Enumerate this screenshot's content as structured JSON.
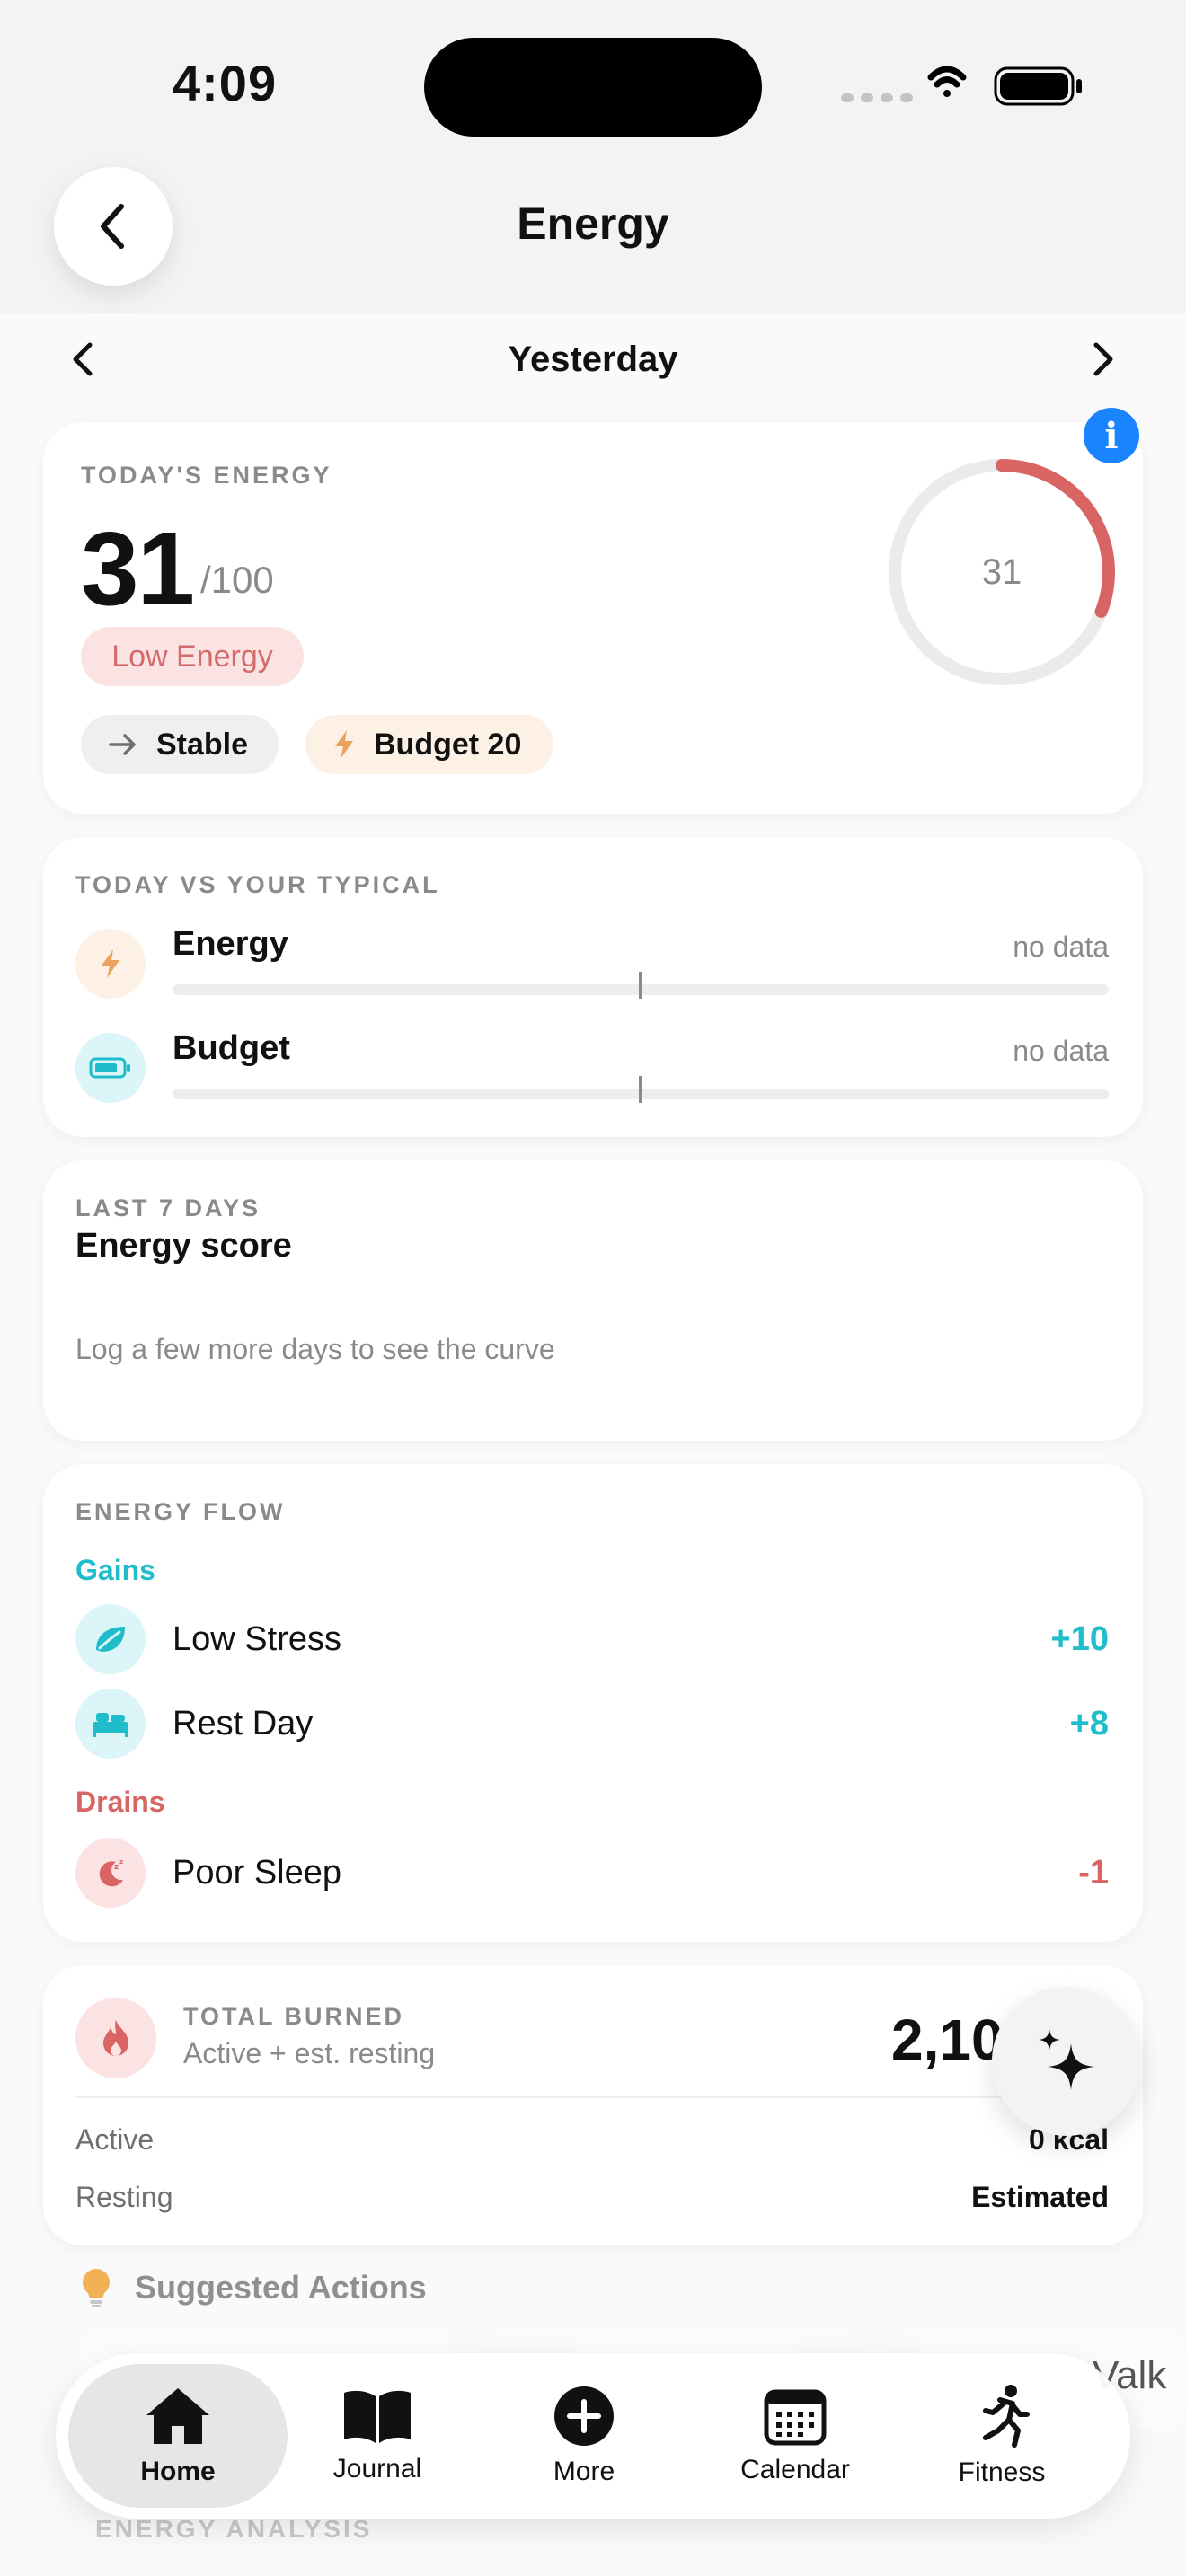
{
  "status_bar": {
    "time": "4:09"
  },
  "header": {
    "title": "Energy"
  },
  "date_nav": {
    "label": "Yesterday"
  },
  "today_energy": {
    "eyebrow": "TODAY'S ENERGY",
    "score": "31",
    "max": "/100",
    "level_badge": "Low Energy",
    "trend_label": "Stable",
    "budget_label": "Budget 20",
    "ring_value": "31",
    "ring_fraction": 0.31,
    "accent_color": "#d96464"
  },
  "typical": {
    "eyebrow": "TODAY VS YOUR TYPICAL",
    "metrics": [
      {
        "name": "Energy",
        "value": "no data",
        "icon": "lightning-icon"
      },
      {
        "name": "Budget",
        "value": "no data",
        "icon": "battery-icon"
      }
    ]
  },
  "last7": {
    "eyebrow": "LAST 7 DAYS",
    "title": "Energy score",
    "empty_message": "Log a few more days to see the curve"
  },
  "flow": {
    "eyebrow": "ENERGY FLOW",
    "gains_label": "Gains",
    "drains_label": "Drains",
    "gains": [
      {
        "name": "Low Stress",
        "value": "+10",
        "icon": "leaf-icon"
      },
      {
        "name": "Rest Day",
        "value": "+8",
        "icon": "bed-icon"
      }
    ],
    "drains": [
      {
        "name": "Poor Sleep",
        "value": "-1",
        "icon": "moon-sleep-icon"
      }
    ],
    "gain_color": "#1fbccb",
    "drain_color": "#d96464"
  },
  "burned": {
    "eyebrow": "TOTAL BURNED",
    "subtitle": "Active + est. resting",
    "total": "2,10",
    "active_label": "Active",
    "active_value": "0 kcal",
    "resting_label": "Resting",
    "resting_value": "Estimated"
  },
  "suggested": {
    "label": "Suggested Actions",
    "overflow_text": "Valk"
  },
  "analysis": {
    "eyebrow": "ENERGY ANALYSIS"
  },
  "tabs": [
    {
      "label": "Home",
      "icon": "home-icon",
      "selected": true
    },
    {
      "label": "Journal",
      "icon": "book-icon"
    },
    {
      "label": "More",
      "icon": "plus-circle-icon"
    },
    {
      "label": "Calendar",
      "icon": "calendar-icon"
    },
    {
      "label": "Fitness",
      "icon": "running-icon"
    }
  ]
}
